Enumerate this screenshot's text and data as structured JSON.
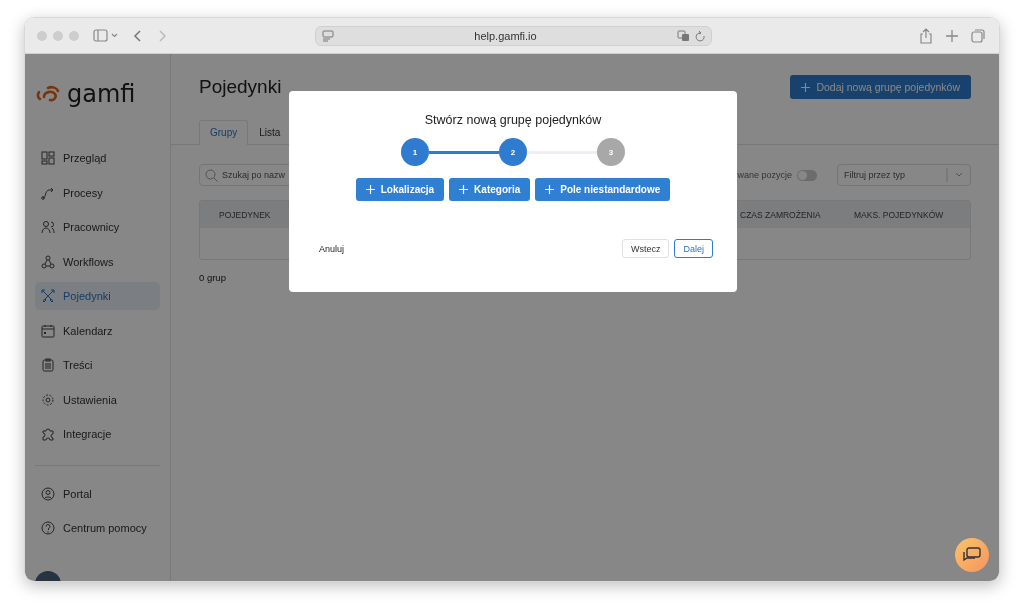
{
  "browser": {
    "url": "help.gamfi.io"
  },
  "sidebar": {
    "logo": "gamfi",
    "items": [
      {
        "label": "Przegląd",
        "selected": false
      },
      {
        "label": "Procesy",
        "selected": false
      },
      {
        "label": "Pracownicy",
        "selected": false
      },
      {
        "label": "Workflows",
        "selected": false
      },
      {
        "label": "Pojedynki",
        "selected": true
      },
      {
        "label": "Kalendarz",
        "selected": false
      },
      {
        "label": "Treści",
        "selected": false
      },
      {
        "label": "Ustawienia",
        "selected": false
      },
      {
        "label": "Integracje",
        "selected": false
      }
    ],
    "bottom_items": [
      {
        "label": "Portal"
      },
      {
        "label": "Centrum pomocy"
      }
    ]
  },
  "page": {
    "title": "Pojedynki",
    "add_button": "Dodaj nową grupę pojedynków",
    "tabs": [
      {
        "label": "Grupy",
        "selected": true
      },
      {
        "label": "Lista",
        "selected": false
      }
    ],
    "search": {
      "placeholder": "Szukaj po nazw"
    },
    "toggle": {
      "label": "wane pozycje",
      "on": false
    },
    "filter": {
      "placeholder": "Filtruj przez typ"
    },
    "table": {
      "columns": [
        {
          "label": "POJEDYNEK",
          "kind": "left"
        },
        {
          "label": "CZAS ZAMROŻENIA",
          "kind": "right1"
        },
        {
          "label": "MAKS. POJEDYNKÓW",
          "kind": "right2"
        }
      ]
    },
    "count": "0 grup"
  },
  "dialog": {
    "title": "Stwórz nową grupę pojedynków",
    "steps": [
      {
        "label": "1",
        "active": true
      },
      {
        "label": "2",
        "active": true
      },
      {
        "label": "3",
        "active": false
      }
    ],
    "add_buttons": [
      "Lokalizacja",
      "Kategoria",
      "Pole niestandardowe"
    ],
    "cancel": "Anuluj",
    "back": "Wstecz",
    "next": "Dalej"
  }
}
